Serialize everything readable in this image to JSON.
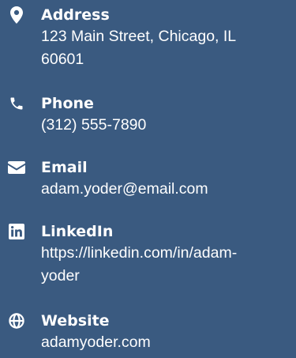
{
  "contacts": {
    "address": {
      "label": "Address",
      "line1": "123 Main Street, Chicago, IL",
      "line2": "60601",
      "icon": "map-marker-icon"
    },
    "phone": {
      "label": "Phone",
      "value": "(312) 555-7890",
      "icon": "phone-icon"
    },
    "email": {
      "label": "Email",
      "value": "adam.yoder@email.com",
      "icon": "envelope-icon"
    },
    "linkedin": {
      "label": "LinkedIn",
      "line1": "https://linkedin.com/in/adam-",
      "line2": "yoder",
      "icon": "linkedin-icon"
    },
    "website": {
      "label": "Website",
      "value": "adamyoder.com",
      "icon": "globe-icon"
    }
  },
  "colors": {
    "background": "#3a5a80",
    "text": "#ffffff"
  }
}
